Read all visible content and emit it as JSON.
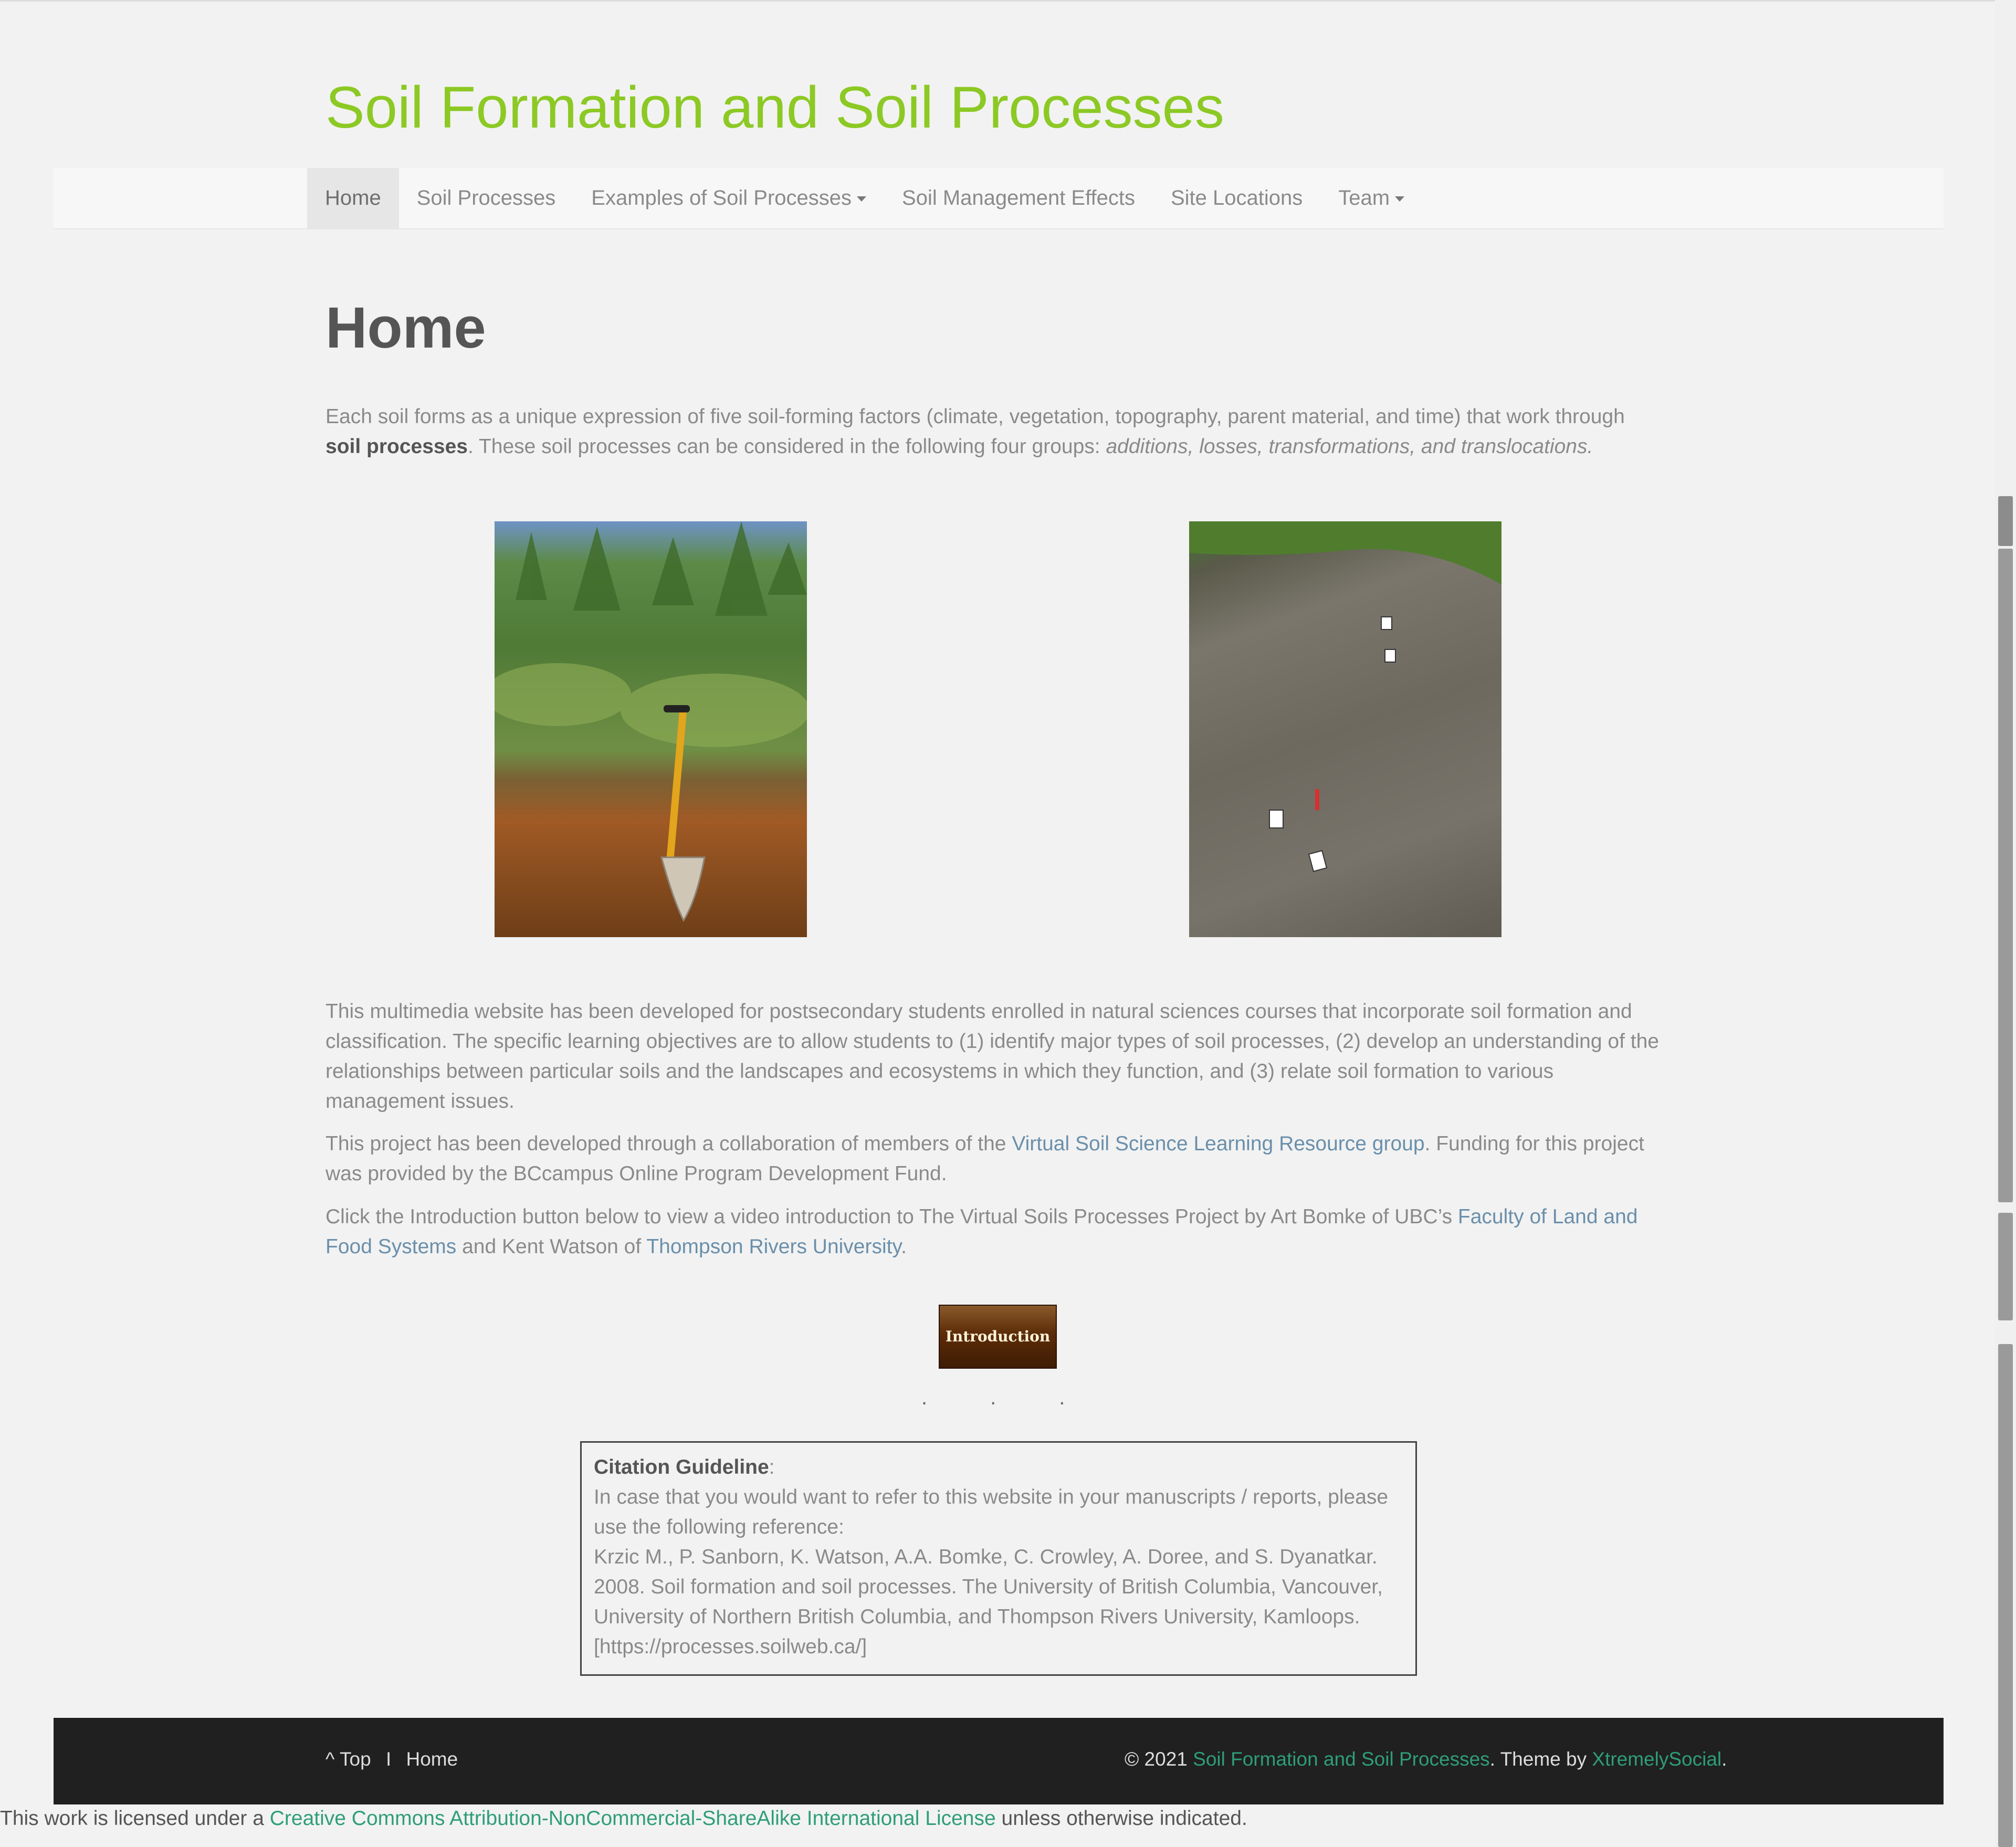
{
  "site": {
    "title": "Soil Formation and Soil Processes"
  },
  "nav": {
    "items": [
      {
        "label": "Home",
        "active": true,
        "dropdown": false
      },
      {
        "label": "Soil Processes",
        "active": false,
        "dropdown": false
      },
      {
        "label": "Examples of Soil Processes",
        "active": false,
        "dropdown": true
      },
      {
        "label": "Soil Management Effects",
        "active": false,
        "dropdown": false
      },
      {
        "label": "Site Locations",
        "active": false,
        "dropdown": false
      },
      {
        "label": "Team",
        "active": false,
        "dropdown": true
      }
    ]
  },
  "page": {
    "heading": "Home",
    "intro": {
      "part1": "Each soil forms as a unique expression of five soil-forming factors (climate, vegetation, topography, parent material, and time) that work through ",
      "bold": "soil processes",
      "part2": ". These soil processes can be considered in the following four groups: ",
      "italic": "additions, losses, transformations, and translocations."
    },
    "images": [
      {
        "name": "soil pit with shovel"
      },
      {
        "name": "soil profile with horizon markers"
      }
    ],
    "para2": "This multimedia website has been developed for postsecondary students enrolled in natural sciences courses that incorporate soil formation and classification. The specific learning objectives are to allow students to (1) identify major types of soil processes, (2) develop an understanding of the relationships between particular soils and the landscapes and ecosystems in which they function, and (3) relate soil formation to various management issues.",
    "para3": {
      "part1": "This project has been developed through a collaboration of members of the ",
      "link": "Virtual Soil Science Learning Resource group",
      "part2": ". Funding for this project was provided by the BCcampus Online Program Development Fund."
    },
    "para4": {
      "part1": "Click the Introduction button below to view a video introduction to The Virtual Soils Processes Project by Art Bomke of UBC’s ",
      "link1": "Faculty of Land and Food Systems",
      "part2": " and Kent Watson of ",
      "link2": "Thompson Rivers University",
      "part3": "."
    },
    "intro_button": "Introduction",
    "dots": ".",
    "citation": {
      "title": "Citation Guideline",
      "colon": ":",
      "line1": "In case that you would want to refer to this website in your manuscripts / reports, please use the following reference:",
      "line2": "Krzic M., P. Sanborn, K. Watson, A.A. Bomke, C. Crowley, A. Doree, and S. Dyanatkar. 2008. Soil formation and soil processes. The University of British Columbia, Vancouver, University of Northern British Columbia, and Thompson Rivers University, Kamloops. [https://processes.soilweb.ca/]"
    }
  },
  "footer": {
    "top_label": "Top",
    "sep": "I",
    "home_label": "Home",
    "copyright": "© 2021 ",
    "site_link": "Soil Formation and Soil Processes",
    "theme_text": ". Theme by ",
    "theme_link": "XtremelySocial",
    "end": "."
  },
  "license": {
    "part1": "This work is licensed under a ",
    "link": "Creative Commons Attribution-NonCommercial-ShareAlike International License",
    "part2": " unless otherwise indicated."
  },
  "colors": {
    "title_green": "#8cc924",
    "link_blue": "#6a8fab",
    "footer_link": "#2e9e7a",
    "footer_bg": "#202020"
  }
}
